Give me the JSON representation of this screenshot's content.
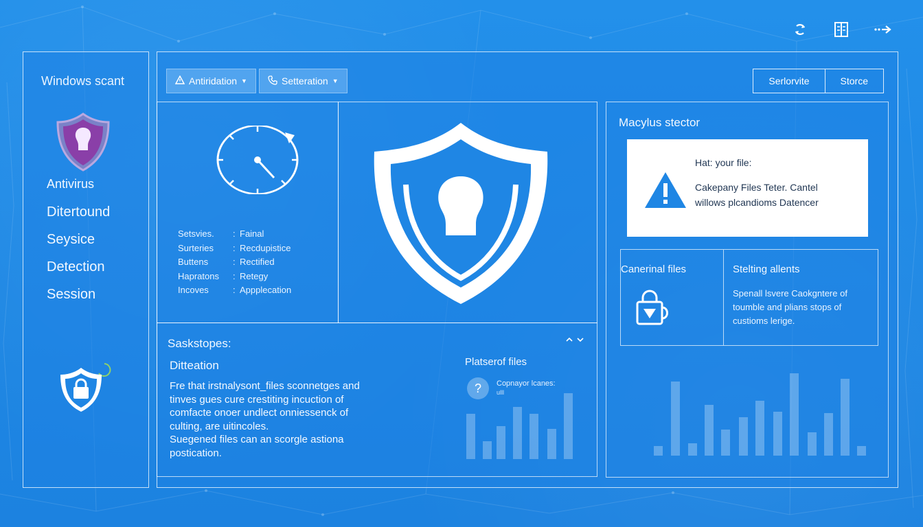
{
  "sidebar": {
    "title": "Windows scant",
    "items": [
      {
        "label": "Antivirus"
      },
      {
        "label": "Ditertound"
      },
      {
        "label": "Seysice"
      },
      {
        "label": "Detection"
      },
      {
        "label": "Session"
      }
    ]
  },
  "toolbar": {
    "button1": {
      "label": "Antiridation",
      "icon": "warning-icon"
    },
    "button2": {
      "label": "Setteration",
      "icon": "phone-icon"
    },
    "seg1": "Serlorvite",
    "seg2": "Storce"
  },
  "info": {
    "rows": [
      {
        "key": "Setsvies.",
        "value": "Fainal"
      },
      {
        "key": "Surteries",
        "value": "Recdupistice"
      },
      {
        "key": "Buttens",
        "value": "Rectified"
      },
      {
        "key": "Hapratons",
        "value": "Retegy"
      },
      {
        "key": "Incoves",
        "value": "Appplecation"
      }
    ]
  },
  "bottom": {
    "heading": "Saskstopes:",
    "subheading": "Ditteation",
    "lines": [
      "Fre that irstnalysont_files sconnetges and",
      "tinves gues cure crestiting incuction of",
      "comfacte onoer undlect onniessenck of",
      "culting, are uitincoles.",
      "Suegened files can an scorgle astiona",
      "postication."
    ]
  },
  "files_chart": {
    "title": "Platserof files",
    "caption": "Copnayor lcanes:",
    "caption2": "ulll",
    "icon": "help-icon"
  },
  "right": {
    "title": "Macylus stector",
    "alert": {
      "heading": "Hat: your file:",
      "line1": "Cakepany Files Teter. Cantel",
      "line2": "willows plcandioms Datencer",
      "icon": "warning-triangle-icon"
    },
    "left_card": {
      "title": "Canerinal files",
      "icon": "lock-cup-icon"
    },
    "right_card": {
      "title": "Stelting allents",
      "lines": [
        "Spenall lsvere Caokgntere of",
        "toumble and plians stops of",
        "custioms lerige."
      ]
    }
  },
  "colors": {
    "background": "#1f86e4",
    "accent_purple": "#8a3fa8",
    "panel_border": "#ffffff"
  },
  "top_icons": [
    "refresh-icon",
    "book-icon",
    "forward-arrow-icon"
  ]
}
